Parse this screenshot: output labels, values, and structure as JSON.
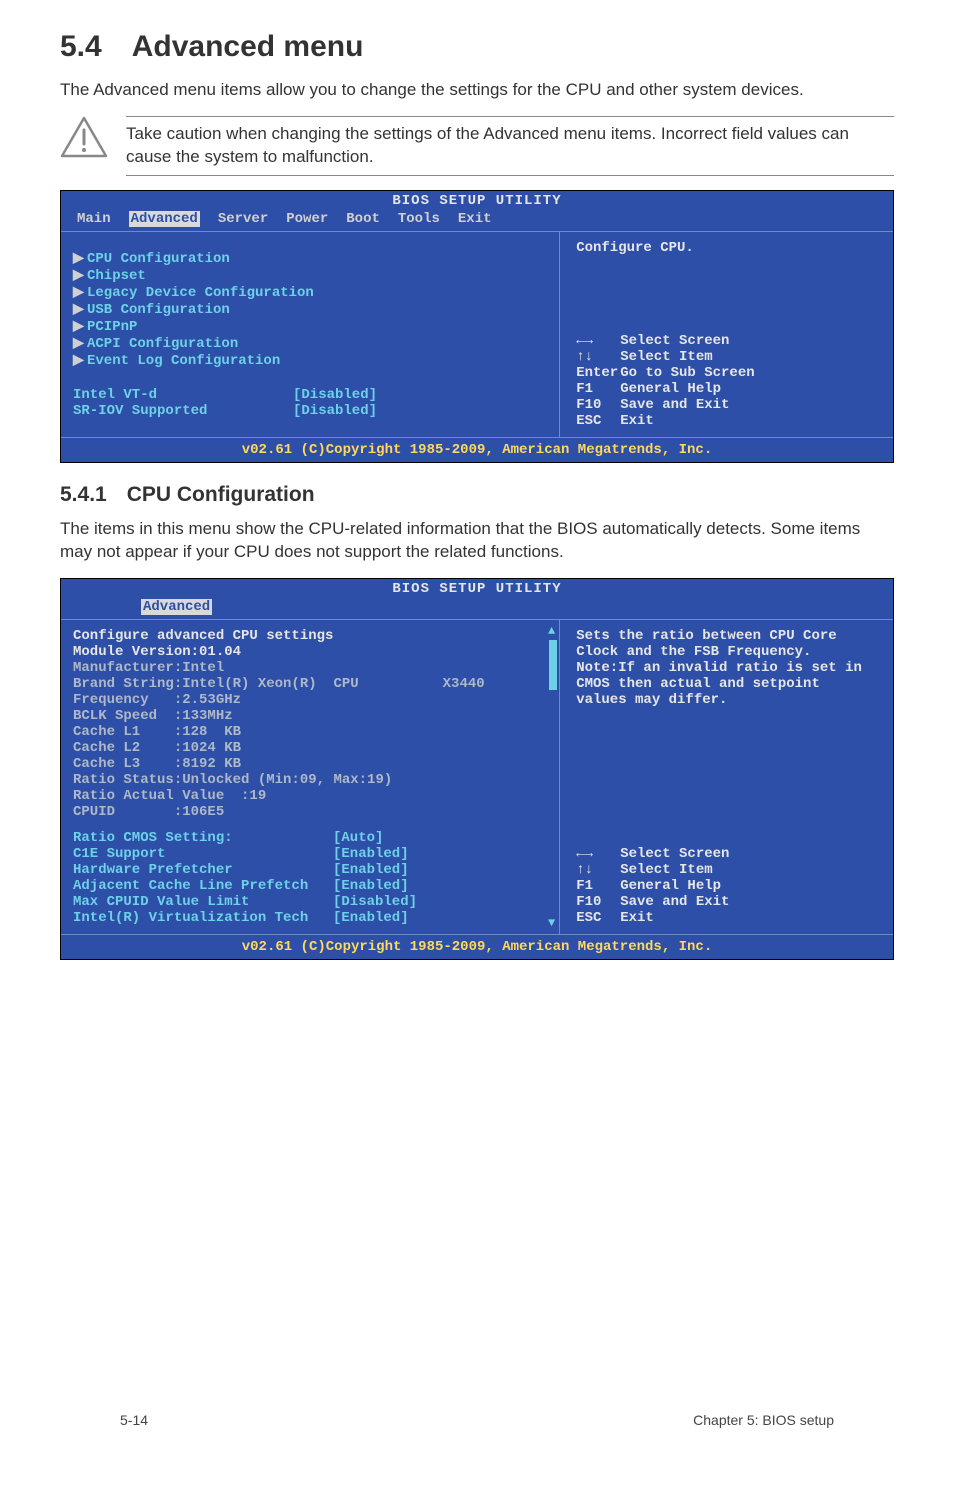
{
  "section": {
    "number": "5.4",
    "title": "Advanced menu"
  },
  "intro": "The Advanced menu items allow you to change the settings for the CPU and other system devices.",
  "warning": "Take caution when changing the settings of the Advanced menu items. Incorrect field values can cause the system to malfunction.",
  "bios1": {
    "title": "BIOS SETUP UTILITY",
    "tabs": [
      "Main",
      "Advanced",
      "Server",
      "Power",
      "Boot",
      "Tools",
      "Exit"
    ],
    "active_tab_index": 1,
    "menu": [
      "CPU Configuration",
      "Chipset",
      "Legacy Device Configuration",
      "USB Configuration",
      "PCIPnP",
      "ACPI Configuration",
      "Event Log Configuration"
    ],
    "settings": [
      {
        "label": "Intel VT-d",
        "value": "[Disabled]"
      },
      {
        "label": "SR-IOV Supported",
        "value": "[Disabled]"
      }
    ],
    "help_top": "Configure CPU.",
    "help_keys": [
      {
        "k": "←→",
        "t": "Select Screen"
      },
      {
        "k": "↑↓",
        "t": "Select Item"
      },
      {
        "k": "Enter",
        "t": "Go to Sub Screen"
      },
      {
        "k": "F1",
        "t": "General Help"
      },
      {
        "k": "F10",
        "t": "Save and Exit"
      },
      {
        "k": "ESC",
        "t": "Exit"
      }
    ],
    "footer": "v02.61 (C)Copyright 1985-2009, American Megatrends, Inc."
  },
  "subsection": {
    "number": "5.4.1",
    "title": "CPU Configuration"
  },
  "sub_intro": "The items in this menu show the CPU-related information that the BIOS automatically detects. Some items may not appear if your CPU does not support the related functions.",
  "bios2": {
    "title": "BIOS SETUP UTILITY",
    "active_tab": "Advanced",
    "heading": "Configure advanced CPU settings",
    "module": "Module Version:01.04",
    "info": [
      "Manufacturer:Intel",
      "Brand String:Intel(R) Xeon(R)  CPU          X3440",
      "Frequency   :2.53GHz",
      "BCLK Speed  :133MHz",
      "Cache L1    :128  KB",
      "Cache L2    :1024 KB",
      "Cache L3    :8192 KB",
      "Ratio Status:Unlocked (Min:09, Max:19)",
      "Ratio Actual Value  :19",
      "CPUID       :106E5"
    ],
    "settings": [
      {
        "label": "Ratio CMOS Setting:",
        "value": "[Auto]"
      },
      {
        "label": "C1E Support",
        "value": "[Enabled]"
      },
      {
        "label": "Hardware Prefetcher",
        "value": "[Enabled]"
      },
      {
        "label": "Adjacent Cache Line Prefetch",
        "value": "[Enabled]"
      },
      {
        "label": "Max CPUID Value Limit",
        "value": "[Disabled]"
      },
      {
        "label": "Intel(R) Virtualization Tech",
        "value": "[Enabled]"
      }
    ],
    "help_top": "Sets the ratio between CPU Core Clock and the FSB Frequency.\nNote:If an invalid ratio is set in CMOS then actual and setpoint values may differ.",
    "help_keys": [
      {
        "k": "←→",
        "t": "Select Screen"
      },
      {
        "k": "↑↓",
        "t": "Select Item"
      },
      {
        "k": "F1",
        "t": "General Help"
      },
      {
        "k": "F10",
        "t": "Save and Exit"
      },
      {
        "k": "ESC",
        "t": "Exit"
      }
    ],
    "footer": "v02.61 (C)Copyright 1985-2009, American Megatrends, Inc."
  },
  "page_footer": {
    "left": "5-14",
    "right": "Chapter 5: BIOS setup"
  }
}
